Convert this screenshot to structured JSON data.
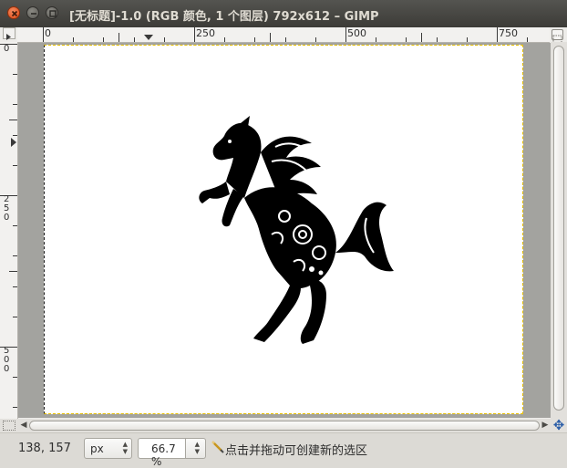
{
  "window": {
    "title": "[无标题]-1.0 (RGB 颜色, 1 个图层) 792x612 – GIMP"
  },
  "ruler": {
    "h_labels": [
      "0",
      "250",
      "500",
      "750"
    ],
    "v_labels": [
      "0",
      "250",
      "500"
    ]
  },
  "canvas": {
    "image_width": 792,
    "image_height": 612,
    "content": "horse-silhouette"
  },
  "status": {
    "coords": "138, 157",
    "unit": "px",
    "zoom": "66.7 %",
    "hint": "点击并拖动可创建新的选区"
  },
  "icons": {
    "close": "close-icon",
    "minimize": "minimize-icon",
    "maximize": "maximize-icon",
    "quickmask": "quick-mask-icon",
    "zoom": "zoom-fit-icon",
    "navigate": "navigate-icon",
    "hint": "pencil-icon"
  }
}
